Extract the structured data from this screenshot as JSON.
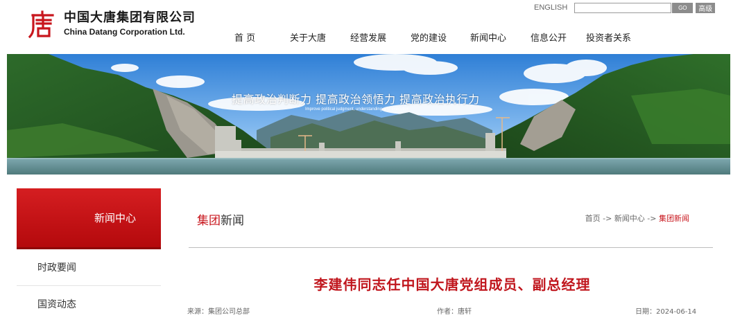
{
  "header": {
    "logo_cn": "中国大唐集团有限公司",
    "logo_en": "China Datang Corporation Ltd.",
    "lang_link": "ENGLISH",
    "search_value": "",
    "go_label": "GO",
    "advanced_label": "高级",
    "brand_color": "#c8161d"
  },
  "nav": [
    {
      "label": "首  页"
    },
    {
      "label": "关于大唐"
    },
    {
      "label": "经营发展"
    },
    {
      "label": "党的建设"
    },
    {
      "label": "新闻中心"
    },
    {
      "label": "信息公开"
    },
    {
      "label": "投资者关系"
    }
  ],
  "banner": {
    "slogan": "提高政治判断力  提高政治领悟力  提高政治执行力",
    "subtitle": "Improve political judgment, understanding and execution"
  },
  "sidebar": {
    "title": "新闻中心",
    "items": [
      {
        "label": "时政要闻"
      },
      {
        "label": "国资动态"
      }
    ]
  },
  "content": {
    "section_title_accent": "集团",
    "section_title_rest": "新闻",
    "breadcrumb": {
      "home": "首页",
      "sep": " -> ",
      "level1": "新闻中心",
      "current": "集团新闻"
    }
  },
  "article": {
    "title": "李建伟同志任中国大唐党组成员、副总经理",
    "source": "来源：集团公司总部",
    "author": "作者：唐轩",
    "date": "日期：2024-06-14"
  }
}
